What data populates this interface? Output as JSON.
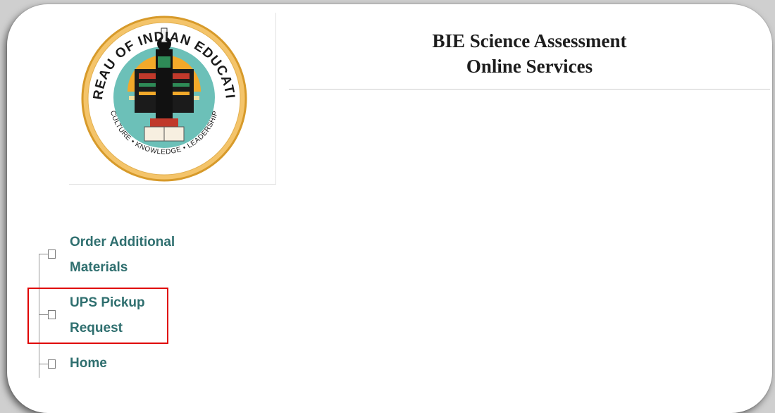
{
  "header": {
    "title_line1": "BIE Science Assessment",
    "title_line2": "Online Services"
  },
  "logo": {
    "arc_top": "BUREAU OF INDIAN EDUCATION",
    "arc_bottom": "CULTURE • KNOWLEDGE • LEADERSHIP",
    "icon": "bie-seal-logo"
  },
  "nav": {
    "items": [
      {
        "line1": "Order Additional",
        "line2": "Materials",
        "icon": "tree-node-icon"
      },
      {
        "line1": "UPS Pickup",
        "line2": "Request",
        "icon": "tree-node-icon",
        "highlighted": true
      },
      {
        "line1": "Home",
        "line2": "",
        "icon": "tree-node-icon"
      }
    ]
  },
  "colors": {
    "nav_text": "#2f6f6f",
    "highlight": "#e00000",
    "seal_teal": "#6cc0b8",
    "seal_gold": "#e8a020"
  }
}
